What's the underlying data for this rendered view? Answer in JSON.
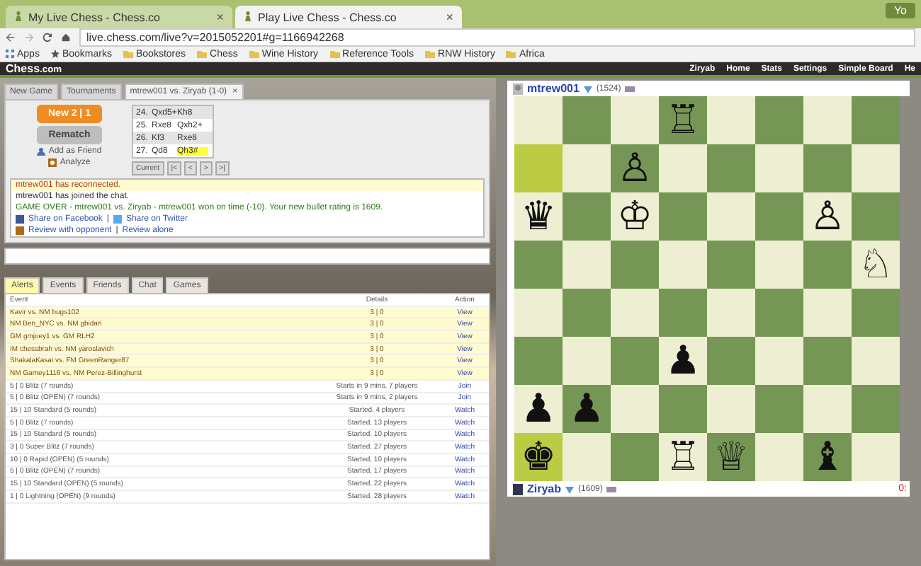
{
  "browser": {
    "tabs": [
      {
        "title": "My Live Chess - Chess.co",
        "selected": false
      },
      {
        "title": "Play Live Chess - Chess.co",
        "selected": true
      }
    ],
    "close_glyph": "×",
    "user_badge": "Yo",
    "address": "live.chess.com/live?v=2015052201#g=1166942268",
    "bookmarks": [
      {
        "label": "Apps",
        "kind": "apps"
      },
      {
        "label": "Bookmarks",
        "kind": "star"
      },
      {
        "label": "Bookstores",
        "kind": "folder"
      },
      {
        "label": "Chess",
        "kind": "folder"
      },
      {
        "label": "Wine History",
        "kind": "folder"
      },
      {
        "label": "Reference Tools",
        "kind": "folder"
      },
      {
        "label": "RNW History",
        "kind": "folder"
      },
      {
        "label": "Africa",
        "kind": "folder"
      }
    ]
  },
  "site": {
    "logo": "Chess",
    "logo_suffix": ".com",
    "user": "Ziryab",
    "nav": [
      "Home",
      "Stats",
      "Settings",
      "Simple Board",
      "He"
    ]
  },
  "game_tabs": [
    {
      "label": "New Game",
      "selected": false
    },
    {
      "label": "Tournaments",
      "selected": false
    },
    {
      "label": "mtrew001 vs. Ziryab (1-0)",
      "selected": true
    }
  ],
  "game_tab_close": "×",
  "actions": {
    "new_game": "New 2 | 1",
    "rematch": "Rematch",
    "add_friend": "Add as Friend",
    "analyze": "Analyze"
  },
  "moves": [
    {
      "number": "24.",
      "white": "Qxd5+",
      "black": "Kh8",
      "highlighted": false
    },
    {
      "number": "25.",
      "white": "Rxe8",
      "black": "Qxh2+",
      "highlighted": false
    },
    {
      "number": "26.",
      "white": "Kf3",
      "black": "Rxe8",
      "highlighted": false
    },
    {
      "number": "27.",
      "white": "Qd8",
      "black": "Qh3#",
      "highlighted": true
    }
  ],
  "move_nav": [
    "Current",
    "|<",
    "<",
    ">",
    ">|"
  ],
  "chat": [
    {
      "kind": "alert",
      "text": "mtrew001 has reconnected."
    },
    {
      "kind": "plain",
      "text": "mtrew001 has joined the chat."
    },
    {
      "kind": "gameover",
      "text": "GAME OVER - mtrew001 vs. Ziryab - mtrew001 won on time (-10). Your new bullet rating is 1609."
    },
    {
      "kind": "share",
      "links": [
        "Share on Facebook",
        "Share on Twitter"
      ],
      "separator": "|"
    },
    {
      "kind": "review",
      "links": [
        "Review with opponent",
        "Review alone"
      ],
      "separator": "|"
    }
  ],
  "event_tabs": [
    {
      "label": "Alerts",
      "selected": true
    },
    {
      "label": "Events",
      "selected": false
    },
    {
      "label": "Friends",
      "selected": false
    },
    {
      "label": "Chat",
      "selected": false
    },
    {
      "label": "Games",
      "selected": false
    }
  ],
  "events": {
    "columns": [
      "Event",
      "Details",
      "Action"
    ],
    "rows": [
      {
        "event": "Kavir vs. NM bugs102",
        "details": "3 | 0",
        "action": "View",
        "live": true
      },
      {
        "event": "NM Ben_NYC vs. NM gbidari",
        "details": "3 | 0",
        "action": "View",
        "live": true
      },
      {
        "event": "GM gmjoey1 vs. GM RLH2",
        "details": "3 | 0",
        "action": "View",
        "live": true
      },
      {
        "event": "IM chessbrah vs. NM yaroslavich",
        "details": "3 | 0",
        "action": "View",
        "live": true
      },
      {
        "event": "ShakalaKasai vs. FM GreenRanger87",
        "details": "3 | 0",
        "action": "View",
        "live": true
      },
      {
        "event": "NM Gamey1116 vs. NM Perez-Billinghurst",
        "details": "3 | 0",
        "action": "View",
        "live": true
      },
      {
        "event": "5 | 0 Blitz (7 rounds)",
        "details": "Starts in 9 mins, 7 players",
        "action": "Join",
        "live": false
      },
      {
        "event": "5 | 0 Blitz (OPEN) (7 rounds)",
        "details": "Starts in 9 mins, 2 players",
        "action": "Join",
        "live": false
      },
      {
        "event": "15 | 10 Standard (5 rounds)",
        "details": "Started, 4 players",
        "action": "Watch",
        "live": false
      },
      {
        "event": "5 | 0 Blitz (7 rounds)",
        "details": "Started, 13 players",
        "action": "Watch",
        "live": false
      },
      {
        "event": "15 | 10 Standard (5 rounds)",
        "details": "Started, 10 players",
        "action": "Watch",
        "live": false
      },
      {
        "event": "3 | 0 Super Blitz (7 rounds)",
        "details": "Started, 27 players",
        "action": "Watch",
        "live": false
      },
      {
        "event": "10 | 0 Rapid (OPEN) (5 rounds)",
        "details": "Started, 10 players",
        "action": "Watch",
        "live": false
      },
      {
        "event": "5 | 0 Blitz (OPEN) (7 rounds)",
        "details": "Started, 17 players",
        "action": "Watch",
        "live": false
      },
      {
        "event": "15 | 10 Standard (OPEN) (5 rounds)",
        "details": "Started, 22 players",
        "action": "Watch",
        "live": false
      },
      {
        "event": "1 | 0 Lightning (OPEN) (9 rounds)",
        "details": "Started, 28 players",
        "action": "Watch",
        "live": false
      }
    ]
  },
  "top_player": {
    "name": "mtrew001",
    "rating": "(1524)"
  },
  "bottom_player": {
    "name": "Ziryab",
    "rating": "(1609)",
    "clock": "0:"
  },
  "board": [
    [
      {
        "hl": false
      },
      {
        "hl": false
      },
      {
        "hl": false
      },
      {
        "piece": "♖",
        "hl": false
      },
      {
        "hl": false
      },
      {
        "hl": false
      },
      {
        "hl": false
      },
      {
        "hl": false
      }
    ],
    [
      {
        "hl": true
      },
      {
        "hl": false
      },
      {
        "piece": "♙",
        "hl": false
      },
      {
        "hl": false
      },
      {
        "hl": false
      },
      {
        "hl": false
      },
      {
        "hl": false
      },
      {
        "hl": false
      }
    ],
    [
      {
        "piece": "♛",
        "hl": false
      },
      {
        "hl": false
      },
      {
        "piece": "♔",
        "hl": false
      },
      {
        "hl": false
      },
      {
        "hl": false
      },
      {
        "hl": false
      },
      {
        "piece": "♙",
        "hl": false
      },
      {
        "hl": false
      }
    ],
    [
      {
        "hl": false
      },
      {
        "hl": false
      },
      {
        "hl": false
      },
      {
        "hl": false
      },
      {
        "hl": false
      },
      {
        "hl": false
      },
      {
        "hl": false
      },
      {
        "piece": "♘",
        "hl": false
      }
    ],
    [
      {
        "hl": false
      },
      {
        "hl": false
      },
      {
        "hl": false
      },
      {
        "hl": false
      },
      {
        "hl": false
      },
      {
        "hl": false
      },
      {
        "hl": false
      },
      {
        "hl": false
      }
    ],
    [
      {
        "hl": false
      },
      {
        "hl": false
      },
      {
        "hl": false
      },
      {
        "piece": "♟",
        "hl": false
      },
      {
        "hl": false
      },
      {
        "hl": false
      },
      {
        "hl": false
      },
      {
        "hl": false
      }
    ],
    [
      {
        "piece": "♟",
        "hl": false
      },
      {
        "piece": "♟",
        "hl": false
      },
      {
        "hl": false
      },
      {
        "hl": false
      },
      {
        "hl": false
      },
      {
        "hl": false
      },
      {
        "hl": false
      },
      {
        "hl": false
      }
    ],
    [
      {
        "piece": "♚",
        "hl": true
      },
      {
        "hl": false
      },
      {
        "hl": false
      },
      {
        "piece": "♖",
        "hl": false
      },
      {
        "piece": "♕",
        "hl": false
      },
      {
        "hl": false
      },
      {
        "piece": "♝",
        "hl": false
      },
      {
        "hl": false
      }
    ]
  ]
}
